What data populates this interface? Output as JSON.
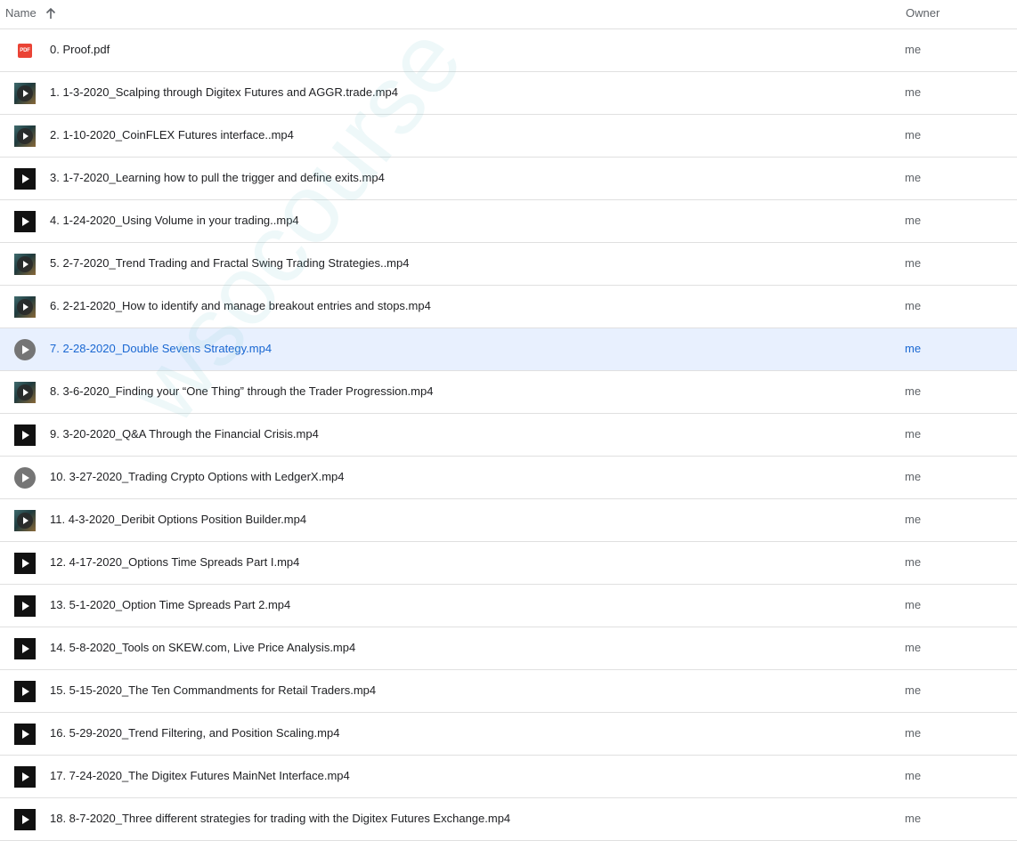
{
  "header": {
    "name_label": "Name",
    "owner_label": "Owner",
    "sort": "ascending"
  },
  "watermark": "wsocourse",
  "colors": {
    "selected_bg": "#e8f0fe",
    "selected_text": "#1967d2",
    "pdf_red": "#ea4335",
    "divider": "#e0e0e0"
  },
  "files": [
    {
      "name": "0. Proof.pdf",
      "owner": "me",
      "icon": "pdf-icon",
      "icon_text": "PDF"
    },
    {
      "name": "1. 1-3-2020_Scalping through Digitex Futures and AGGR.trade.mp4",
      "owner": "me",
      "icon": "video-thumbnail-icon"
    },
    {
      "name": "2. 1-10-2020_CoinFLEX Futures interface..mp4",
      "owner": "me",
      "icon": "video-thumbnail-icon"
    },
    {
      "name": "3. 1-7-2020_Learning how to pull the trigger and define exits.mp4",
      "owner": "me",
      "icon": "video-icon"
    },
    {
      "name": "4. 1-24-2020_Using Volume in your trading..mp4",
      "owner": "me",
      "icon": "video-icon"
    },
    {
      "name": "5. 2-7-2020_Trend Trading and Fractal Swing Trading Strategies..mp4",
      "owner": "me",
      "icon": "video-thumbnail-icon"
    },
    {
      "name": "6. 2-21-2020_How to identify and manage breakout entries and stops.mp4",
      "owner": "me",
      "icon": "video-thumbnail-icon"
    },
    {
      "name": "7. 2-28-2020_Double Sevens Strategy.mp4",
      "owner": "me",
      "icon": "play-circle-icon",
      "selected": true
    },
    {
      "name": "8. 3-6-2020_Finding your “One Thing” through the Trader Progression.mp4",
      "owner": "me",
      "icon": "video-thumbnail-icon"
    },
    {
      "name": "9. 3-20-2020_Q&A Through the Financial Crisis.mp4",
      "owner": "me",
      "icon": "video-icon"
    },
    {
      "name": "10. 3-27-2020_Trading Crypto Options with LedgerX.mp4",
      "owner": "me",
      "icon": "play-circle-icon"
    },
    {
      "name": "11. 4-3-2020_Deribit Options Position Builder.mp4",
      "owner": "me",
      "icon": "video-thumbnail-icon"
    },
    {
      "name": "12. 4-17-2020_Options Time Spreads Part I.mp4",
      "owner": "me",
      "icon": "video-icon"
    },
    {
      "name": "13. 5-1-2020_Option Time Spreads Part 2.mp4",
      "owner": "me",
      "icon": "video-icon"
    },
    {
      "name": "14. 5-8-2020_Tools on SKEW.com, Live Price Analysis.mp4",
      "owner": "me",
      "icon": "video-icon"
    },
    {
      "name": "15. 5-15-2020_The Ten Commandments for Retail Traders.mp4",
      "owner": "me",
      "icon": "video-icon"
    },
    {
      "name": "16. 5-29-2020_Trend Filtering, and Position Scaling.mp4",
      "owner": "me",
      "icon": "video-icon"
    },
    {
      "name": "17. 7-24-2020_The Digitex Futures MainNet Interface.mp4",
      "owner": "me",
      "icon": "video-icon"
    },
    {
      "name": "18. 8-7-2020_Three different strategies for trading with the Digitex Futures Exchange.mp4",
      "owner": "me",
      "icon": "video-icon"
    }
  ]
}
